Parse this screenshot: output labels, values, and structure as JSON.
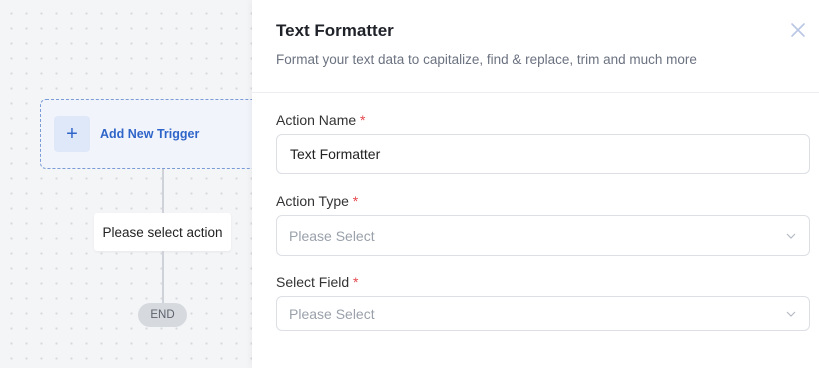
{
  "canvas": {
    "trigger": {
      "label": "Add New Trigger"
    },
    "action": {
      "label": "Please select action"
    },
    "end": {
      "label": "END"
    }
  },
  "panel": {
    "title": "Text Formatter",
    "subtitle": "Format your text data to capitalize, find & replace, trim and much more",
    "fields": {
      "action_name": {
        "label": "Action Name",
        "required_mark": "*",
        "value": "Text Formatter"
      },
      "action_type": {
        "label": "Action Type",
        "required_mark": "*",
        "placeholder": "Please Select"
      },
      "select_field": {
        "label": "Select Field",
        "required_mark": "*",
        "placeholder": "Please Select"
      }
    }
  },
  "colors": {
    "accent": "#2f65c9",
    "required": "#e5484d"
  },
  "icons": {
    "plus": "plus-icon",
    "close": "close-icon",
    "chevron": "chevron-down-icon"
  }
}
